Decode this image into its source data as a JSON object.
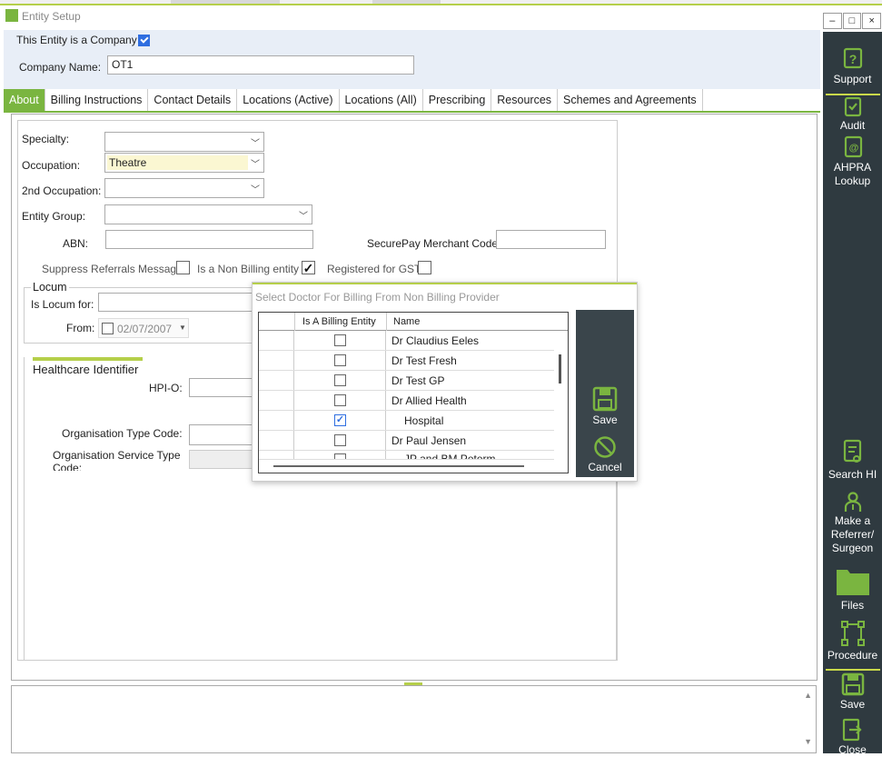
{
  "window": {
    "title": "Entity Setup",
    "controls": [
      "–",
      "□",
      "×"
    ]
  },
  "company": {
    "is_company_label": "This Entity is a Company",
    "is_company_checked": true,
    "name_label": "Company Name:",
    "name_value": "OT1"
  },
  "tabs": [
    {
      "label": "About",
      "active": true
    },
    {
      "label": "Billing Instructions"
    },
    {
      "label": "Contact Details"
    },
    {
      "label": "Locations (Active)"
    },
    {
      "label": "Locations (All)"
    },
    {
      "label": "Prescribing"
    },
    {
      "label": "Resources"
    },
    {
      "label": "Schemes and Agreements"
    }
  ],
  "about": {
    "specialty_label": "Specialty:",
    "specialty_value": "",
    "occupation_label": "Occupation:",
    "occupation_value": "Theatre",
    "occupation2_label": "2nd Occupation:",
    "occupation2_value": "",
    "entity_group_label": "Entity Group:",
    "entity_group_value": "",
    "abn_label": "ABN:",
    "abn_value": "",
    "securepay_label": "SecurePay Merchant Code:",
    "securepay_value": "",
    "suppress_label": "Suppress Referrals Message",
    "suppress_checked": false,
    "non_billing_label": "Is a Non Billing entity",
    "non_billing_checked": true,
    "gst_label": "Registered for GST",
    "gst_checked": false
  },
  "locum": {
    "group_label": "Locum",
    "for_label": "Is Locum for:",
    "for_value": "",
    "from_label": "From:",
    "from_value": "02/07/2007"
  },
  "healthcare": {
    "group_label": "Healthcare Identifier",
    "hpio_label": "HPI-O:",
    "hpio_value": "",
    "org_type_label": "Organisation Type Code:",
    "org_service_label": "Organisation Service Type Code:"
  },
  "dialog": {
    "title": "Select Doctor For Billing From Non Billing Provider",
    "col_billing": "Is A Billing Entity",
    "col_name": "Name",
    "rows": [
      {
        "name": "Dr Claudius Eeles",
        "checked": false
      },
      {
        "name": "Dr Test Fresh",
        "checked": false
      },
      {
        "name": "Dr Test GP",
        "checked": false
      },
      {
        "name": "Dr Allied Health",
        "checked": false
      },
      {
        "name": "Hospital",
        "checked": true
      },
      {
        "name": "Dr Paul Jensen",
        "checked": false
      },
      {
        "name": "JP and BM Peterm Partnership",
        "checked": false
      }
    ],
    "save_label": "Save",
    "cancel_label": "Cancel"
  },
  "sidebar": {
    "support": "Support",
    "audit": "Audit",
    "ahpra": "AHPRA Lookup",
    "search_hi": "Search HI",
    "make_referrer": "Make a Referrer/ Surgeon",
    "files": "Files",
    "procedure": "Procedure",
    "save": "Save",
    "close": "Close"
  },
  "colors": {
    "accent": "#7ab540",
    "sidebar": "#2f3a40",
    "check_blue": "#2f6ee0"
  }
}
